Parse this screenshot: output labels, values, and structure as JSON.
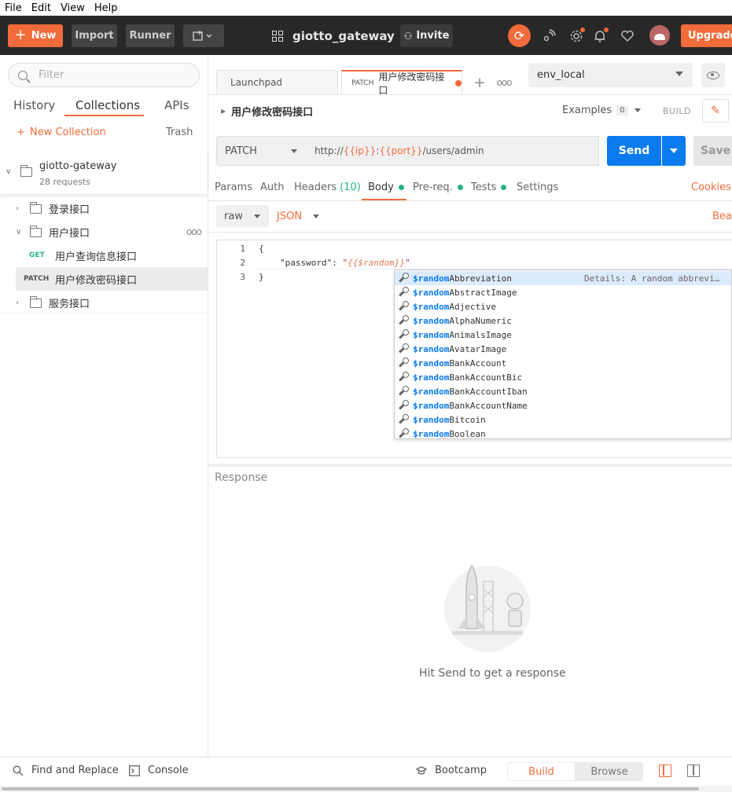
{
  "menubar": [
    "File",
    "Edit",
    "View",
    "Help"
  ],
  "header": {
    "new_label": "New",
    "import_label": "Import",
    "runner_label": "Runner",
    "workspace": "giotto_gateway",
    "invite_label": "Invite",
    "upgrade_label": "Upgrade"
  },
  "sidebar": {
    "filter_placeholder": "Filter",
    "tabs": [
      "History",
      "Collections",
      "APIs"
    ],
    "new_collection": "New Collection",
    "trash": "Trash",
    "collection": {
      "name": "giotto-gateway",
      "count": "28 requests"
    },
    "folders": {
      "login": "登录接口",
      "user": "用户接口",
      "service": "服务接口"
    },
    "requests": [
      {
        "method": "GET",
        "name": "用户查询信息接口",
        "color": "#26b47f"
      },
      {
        "method": "PATCH",
        "name": "用户修改密码接口",
        "color": "#555555"
      }
    ]
  },
  "tabs": {
    "launchpad": "Launchpad",
    "active_method": "PATCH",
    "active_name": "用户修改密码接口"
  },
  "environment": {
    "selected": "env_local"
  },
  "request": {
    "title": "用户修改密码接口",
    "examples_label": "Examples",
    "examples_count": "0",
    "build_label": "BUILD",
    "method": "PATCH",
    "url_parts": {
      "scheme": "http://",
      "ip": "{{ip}}",
      "colon": ":",
      "port": "{{port}}",
      "path": "/users/admin"
    },
    "send_label": "Send",
    "save_label": "Save"
  },
  "req_tabs": {
    "params": "Params",
    "auth": "Auth",
    "headers": "Headers",
    "headers_count": "(10)",
    "body": "Body",
    "prereq": "Pre-req.",
    "tests": "Tests",
    "settings": "Settings",
    "cookies": "Cookies"
  },
  "body_mode": {
    "mode": "raw",
    "format": "JSON",
    "beautify": "Beau"
  },
  "editor": {
    "line_numbers": [
      "1",
      "2",
      "3"
    ],
    "line1": "{",
    "line2_key": "\"password\"",
    "line2_colon": ": ",
    "line2_quote_open": "\"",
    "line2_var": "{{$random}}",
    "line2_quote_close": "\"",
    "line3": "}"
  },
  "autocomplete": {
    "prefix": "$random",
    "items": [
      "Abbreviation",
      "AbstractImage",
      "Adjective",
      "AlphaNumeric",
      "AnimalsImage",
      "AvatarImage",
      "BankAccount",
      "BankAccountBic",
      "BankAccountIban",
      "BankAccountName",
      "Bitcoin",
      "Boolean"
    ],
    "detail": "Details: A random abbrevi…"
  },
  "response": {
    "label": "Response",
    "hint": "Hit Send to get a response"
  },
  "footer": {
    "find_replace": "Find and Replace",
    "console": "Console",
    "bootcamp": "Bootcamp",
    "build": "Build",
    "browse": "Browse"
  },
  "colors": {
    "accent": "#f26b3a",
    "send": "#097bed",
    "green": "#26b47f"
  }
}
